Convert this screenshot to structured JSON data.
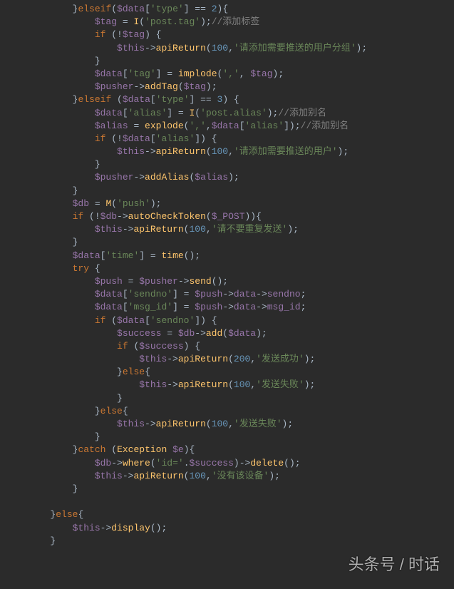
{
  "code": {
    "lines": [
      {
        "i": 3,
        "t": [
          {
            "c": "punc",
            "v": "}"
          },
          {
            "c": "kw",
            "v": "elseif"
          },
          {
            "c": "punc",
            "v": "("
          },
          {
            "c": "var",
            "v": "$data"
          },
          {
            "c": "punc",
            "v": "["
          },
          {
            "c": "str",
            "v": "'type'"
          },
          {
            "c": "punc",
            "v": "] == "
          },
          {
            "c": "num",
            "v": "2"
          },
          {
            "c": "punc",
            "v": "){"
          }
        ]
      },
      {
        "i": 4,
        "t": [
          {
            "c": "var",
            "v": "$tag"
          },
          {
            "c": "punc",
            "v": " = "
          },
          {
            "c": "func",
            "v": "I"
          },
          {
            "c": "punc",
            "v": "("
          },
          {
            "c": "str",
            "v": "'post.tag'"
          },
          {
            "c": "punc",
            "v": ");"
          },
          {
            "c": "comment",
            "v": "//添加标签"
          }
        ]
      },
      {
        "i": 4,
        "t": [
          {
            "c": "kw",
            "v": "if"
          },
          {
            "c": "punc",
            "v": " (!"
          },
          {
            "c": "var",
            "v": "$tag"
          },
          {
            "c": "punc",
            "v": ") {"
          }
        ]
      },
      {
        "i": 5,
        "t": [
          {
            "c": "var",
            "v": "$this"
          },
          {
            "c": "punc",
            "v": "->"
          },
          {
            "c": "func",
            "v": "apiReturn"
          },
          {
            "c": "punc",
            "v": "("
          },
          {
            "c": "num",
            "v": "100"
          },
          {
            "c": "punc",
            "v": ","
          },
          {
            "c": "str",
            "v": "'请添加需要推送的用户分组'"
          },
          {
            "c": "punc",
            "v": ");"
          }
        ]
      },
      {
        "i": 4,
        "t": [
          {
            "c": "punc",
            "v": "}"
          }
        ]
      },
      {
        "i": 4,
        "t": [
          {
            "c": "var",
            "v": "$data"
          },
          {
            "c": "punc",
            "v": "["
          },
          {
            "c": "str",
            "v": "'tag'"
          },
          {
            "c": "punc",
            "v": "] = "
          },
          {
            "c": "func",
            "v": "implode"
          },
          {
            "c": "punc",
            "v": "("
          },
          {
            "c": "str",
            "v": "','"
          },
          {
            "c": "punc",
            "v": ", "
          },
          {
            "c": "var",
            "v": "$tag"
          },
          {
            "c": "punc",
            "v": ");"
          }
        ]
      },
      {
        "i": 4,
        "t": [
          {
            "c": "var",
            "v": "$pusher"
          },
          {
            "c": "punc",
            "v": "->"
          },
          {
            "c": "func",
            "v": "addTag"
          },
          {
            "c": "punc",
            "v": "("
          },
          {
            "c": "var",
            "v": "$tag"
          },
          {
            "c": "punc",
            "v": ");"
          }
        ]
      },
      {
        "i": 3,
        "t": [
          {
            "c": "punc",
            "v": "}"
          },
          {
            "c": "kw",
            "v": "elseif"
          },
          {
            "c": "punc",
            "v": " ("
          },
          {
            "c": "var",
            "v": "$data"
          },
          {
            "c": "punc",
            "v": "["
          },
          {
            "c": "str",
            "v": "'type'"
          },
          {
            "c": "punc",
            "v": "] == "
          },
          {
            "c": "num",
            "v": "3"
          },
          {
            "c": "punc",
            "v": ") {"
          }
        ]
      },
      {
        "i": 4,
        "t": [
          {
            "c": "var",
            "v": "$data"
          },
          {
            "c": "punc",
            "v": "["
          },
          {
            "c": "str",
            "v": "'alias'"
          },
          {
            "c": "punc",
            "v": "] = "
          },
          {
            "c": "func",
            "v": "I"
          },
          {
            "c": "punc",
            "v": "("
          },
          {
            "c": "str",
            "v": "'post.alias'"
          },
          {
            "c": "punc",
            "v": ");"
          },
          {
            "c": "comment",
            "v": "//添加别名"
          }
        ]
      },
      {
        "i": 4,
        "t": [
          {
            "c": "var",
            "v": "$alias"
          },
          {
            "c": "punc",
            "v": " = "
          },
          {
            "c": "func",
            "v": "explode"
          },
          {
            "c": "punc",
            "v": "("
          },
          {
            "c": "str",
            "v": "','"
          },
          {
            "c": "punc",
            "v": ","
          },
          {
            "c": "var",
            "v": "$data"
          },
          {
            "c": "punc",
            "v": "["
          },
          {
            "c": "str",
            "v": "'alias'"
          },
          {
            "c": "punc",
            "v": "]);"
          },
          {
            "c": "comment",
            "v": "//添加别名"
          }
        ]
      },
      {
        "i": 4,
        "t": [
          {
            "c": "kw",
            "v": "if"
          },
          {
            "c": "punc",
            "v": " (!"
          },
          {
            "c": "var",
            "v": "$data"
          },
          {
            "c": "punc",
            "v": "["
          },
          {
            "c": "str",
            "v": "'alias'"
          },
          {
            "c": "punc",
            "v": "]) {"
          }
        ]
      },
      {
        "i": 5,
        "t": [
          {
            "c": "var",
            "v": "$this"
          },
          {
            "c": "punc",
            "v": "->"
          },
          {
            "c": "func",
            "v": "apiReturn"
          },
          {
            "c": "punc",
            "v": "("
          },
          {
            "c": "num",
            "v": "100"
          },
          {
            "c": "punc",
            "v": ","
          },
          {
            "c": "str",
            "v": "'请添加需要推送的用户'"
          },
          {
            "c": "punc",
            "v": ");"
          }
        ]
      },
      {
        "i": 4,
        "t": [
          {
            "c": "punc",
            "v": "}"
          }
        ]
      },
      {
        "i": 4,
        "t": [
          {
            "c": "var",
            "v": "$pusher"
          },
          {
            "c": "punc",
            "v": "->"
          },
          {
            "c": "func",
            "v": "addAlias"
          },
          {
            "c": "punc",
            "v": "("
          },
          {
            "c": "var",
            "v": "$alias"
          },
          {
            "c": "punc",
            "v": ");"
          }
        ]
      },
      {
        "i": 3,
        "t": [
          {
            "c": "punc",
            "v": "}"
          }
        ]
      },
      {
        "i": 3,
        "t": [
          {
            "c": "var",
            "v": "$db"
          },
          {
            "c": "punc",
            "v": " = "
          },
          {
            "c": "func",
            "v": "M"
          },
          {
            "c": "punc",
            "v": "("
          },
          {
            "c": "str",
            "v": "'push'"
          },
          {
            "c": "punc",
            "v": ");"
          }
        ]
      },
      {
        "i": 3,
        "t": [
          {
            "c": "kw",
            "v": "if"
          },
          {
            "c": "punc",
            "v": " (!"
          },
          {
            "c": "var",
            "v": "$db"
          },
          {
            "c": "punc",
            "v": "->"
          },
          {
            "c": "func",
            "v": "autoCheckToken"
          },
          {
            "c": "punc",
            "v": "("
          },
          {
            "c": "var",
            "v": "$_POST"
          },
          {
            "c": "punc",
            "v": ")){"
          }
        ]
      },
      {
        "i": 4,
        "t": [
          {
            "c": "var",
            "v": "$this"
          },
          {
            "c": "punc",
            "v": "->"
          },
          {
            "c": "func",
            "v": "apiReturn"
          },
          {
            "c": "punc",
            "v": "("
          },
          {
            "c": "num",
            "v": "100"
          },
          {
            "c": "punc",
            "v": ","
          },
          {
            "c": "str",
            "v": "'请不要重复发送'"
          },
          {
            "c": "punc",
            "v": ");"
          }
        ]
      },
      {
        "i": 3,
        "t": [
          {
            "c": "punc",
            "v": "}"
          }
        ]
      },
      {
        "i": 3,
        "t": [
          {
            "c": "var",
            "v": "$data"
          },
          {
            "c": "punc",
            "v": "["
          },
          {
            "c": "str",
            "v": "'time'"
          },
          {
            "c": "punc",
            "v": "] = "
          },
          {
            "c": "func",
            "v": "time"
          },
          {
            "c": "punc",
            "v": "();"
          }
        ]
      },
      {
        "i": 3,
        "t": [
          {
            "c": "kw",
            "v": "try"
          },
          {
            "c": "punc",
            "v": " {"
          }
        ]
      },
      {
        "i": 4,
        "t": [
          {
            "c": "var",
            "v": "$push"
          },
          {
            "c": "punc",
            "v": " = "
          },
          {
            "c": "var",
            "v": "$pusher"
          },
          {
            "c": "punc",
            "v": "->"
          },
          {
            "c": "func",
            "v": "send"
          },
          {
            "c": "punc",
            "v": "();"
          }
        ]
      },
      {
        "i": 4,
        "t": [
          {
            "c": "var",
            "v": "$data"
          },
          {
            "c": "punc",
            "v": "["
          },
          {
            "c": "str",
            "v": "'sendno'"
          },
          {
            "c": "punc",
            "v": "] = "
          },
          {
            "c": "var",
            "v": "$push"
          },
          {
            "c": "punc",
            "v": "->"
          },
          {
            "c": "var",
            "v": "data"
          },
          {
            "c": "punc",
            "v": "->"
          },
          {
            "c": "var",
            "v": "sendno"
          },
          {
            "c": "punc",
            "v": ";"
          }
        ]
      },
      {
        "i": 4,
        "t": [
          {
            "c": "var",
            "v": "$data"
          },
          {
            "c": "punc",
            "v": "["
          },
          {
            "c": "str",
            "v": "'msg_id'"
          },
          {
            "c": "punc",
            "v": "] = "
          },
          {
            "c": "var",
            "v": "$push"
          },
          {
            "c": "punc",
            "v": "->"
          },
          {
            "c": "var",
            "v": "data"
          },
          {
            "c": "punc",
            "v": "->"
          },
          {
            "c": "var",
            "v": "msg_id"
          },
          {
            "c": "punc",
            "v": ";"
          }
        ]
      },
      {
        "i": 4,
        "t": [
          {
            "c": "kw",
            "v": "if"
          },
          {
            "c": "punc",
            "v": " ("
          },
          {
            "c": "var",
            "v": "$data"
          },
          {
            "c": "punc",
            "v": "["
          },
          {
            "c": "str",
            "v": "'sendno'"
          },
          {
            "c": "punc",
            "v": "]) {"
          }
        ]
      },
      {
        "i": 5,
        "t": [
          {
            "c": "var",
            "v": "$success"
          },
          {
            "c": "punc",
            "v": " = "
          },
          {
            "c": "var",
            "v": "$db"
          },
          {
            "c": "punc",
            "v": "->"
          },
          {
            "c": "func",
            "v": "add"
          },
          {
            "c": "punc",
            "v": "("
          },
          {
            "c": "var",
            "v": "$data"
          },
          {
            "c": "punc",
            "v": ");"
          }
        ]
      },
      {
        "i": 5,
        "t": [
          {
            "c": "kw",
            "v": "if"
          },
          {
            "c": "punc",
            "v": " ("
          },
          {
            "c": "var",
            "v": "$success"
          },
          {
            "c": "punc",
            "v": ") {"
          }
        ]
      },
      {
        "i": 6,
        "t": [
          {
            "c": "var",
            "v": "$this"
          },
          {
            "c": "punc",
            "v": "->"
          },
          {
            "c": "func",
            "v": "apiReturn"
          },
          {
            "c": "punc",
            "v": "("
          },
          {
            "c": "num",
            "v": "200"
          },
          {
            "c": "punc",
            "v": ","
          },
          {
            "c": "str",
            "v": "'发送成功'"
          },
          {
            "c": "punc",
            "v": ");"
          }
        ]
      },
      {
        "i": 5,
        "t": [
          {
            "c": "punc",
            "v": "}"
          },
          {
            "c": "kw",
            "v": "else"
          },
          {
            "c": "punc",
            "v": "{"
          }
        ]
      },
      {
        "i": 6,
        "t": [
          {
            "c": "var",
            "v": "$this"
          },
          {
            "c": "punc",
            "v": "->"
          },
          {
            "c": "func",
            "v": "apiReturn"
          },
          {
            "c": "punc",
            "v": "("
          },
          {
            "c": "num",
            "v": "100"
          },
          {
            "c": "punc",
            "v": ","
          },
          {
            "c": "str",
            "v": "'发送失败'"
          },
          {
            "c": "punc",
            "v": ");"
          }
        ]
      },
      {
        "i": 5,
        "t": [
          {
            "c": "punc",
            "v": "}"
          }
        ]
      },
      {
        "i": 4,
        "t": [
          {
            "c": "punc",
            "v": "}"
          },
          {
            "c": "kw",
            "v": "else"
          },
          {
            "c": "punc",
            "v": "{"
          }
        ]
      },
      {
        "i": 5,
        "t": [
          {
            "c": "var",
            "v": "$this"
          },
          {
            "c": "punc",
            "v": "->"
          },
          {
            "c": "func",
            "v": "apiReturn"
          },
          {
            "c": "punc",
            "v": "("
          },
          {
            "c": "num",
            "v": "100"
          },
          {
            "c": "punc",
            "v": ","
          },
          {
            "c": "str",
            "v": "'发送失败'"
          },
          {
            "c": "punc",
            "v": ");"
          }
        ]
      },
      {
        "i": 4,
        "t": [
          {
            "c": "punc",
            "v": "}"
          }
        ]
      },
      {
        "i": 3,
        "t": [
          {
            "c": "punc",
            "v": "}"
          },
          {
            "c": "kw",
            "v": "catch"
          },
          {
            "c": "punc",
            "v": " ("
          },
          {
            "c": "const",
            "v": "Exception"
          },
          {
            "c": "punc",
            "v": " "
          },
          {
            "c": "var",
            "v": "$e"
          },
          {
            "c": "punc",
            "v": "){"
          }
        ]
      },
      {
        "i": 4,
        "t": [
          {
            "c": "var",
            "v": "$db"
          },
          {
            "c": "punc",
            "v": "->"
          },
          {
            "c": "func",
            "v": "where"
          },
          {
            "c": "punc",
            "v": "("
          },
          {
            "c": "str",
            "v": "'id='"
          },
          {
            "c": "punc",
            "v": "."
          },
          {
            "c": "var",
            "v": "$success"
          },
          {
            "c": "punc",
            "v": ")->"
          },
          {
            "c": "func",
            "v": "delete"
          },
          {
            "c": "punc",
            "v": "();"
          }
        ]
      },
      {
        "i": 4,
        "t": [
          {
            "c": "var",
            "v": "$this"
          },
          {
            "c": "punc",
            "v": "->"
          },
          {
            "c": "func",
            "v": "apiReturn"
          },
          {
            "c": "punc",
            "v": "("
          },
          {
            "c": "num",
            "v": "100"
          },
          {
            "c": "punc",
            "v": ","
          },
          {
            "c": "str",
            "v": "'没有该设备'"
          },
          {
            "c": "punc",
            "v": ");"
          }
        ]
      },
      {
        "i": 3,
        "t": [
          {
            "c": "punc",
            "v": "}"
          }
        ]
      },
      {
        "i": 3,
        "t": [
          {
            "c": "punc",
            "v": ""
          }
        ]
      },
      {
        "i": 2,
        "t": [
          {
            "c": "punc",
            "v": "}"
          },
          {
            "c": "kw",
            "v": "else"
          },
          {
            "c": "punc",
            "v": "{"
          }
        ]
      },
      {
        "i": 3,
        "t": [
          {
            "c": "var",
            "v": "$this"
          },
          {
            "c": "punc",
            "v": "->"
          },
          {
            "c": "func",
            "v": "display"
          },
          {
            "c": "punc",
            "v": "();"
          }
        ]
      },
      {
        "i": 2,
        "t": [
          {
            "c": "punc",
            "v": "}"
          }
        ]
      }
    ]
  },
  "watermark": "头条号 / 时话"
}
